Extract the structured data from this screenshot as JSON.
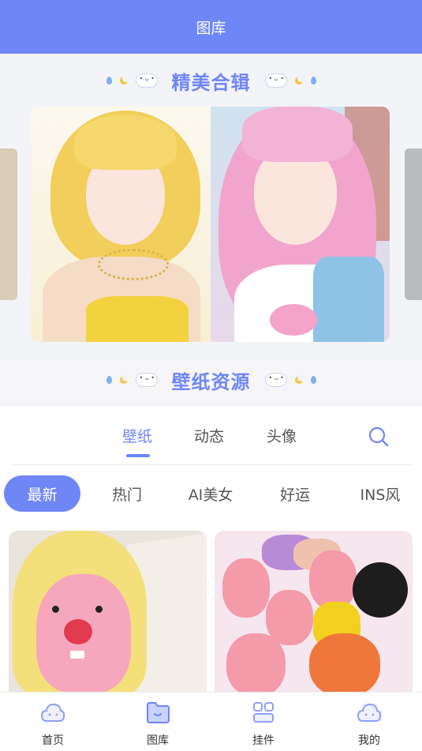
{
  "header": {
    "title": "图库"
  },
  "featured": {
    "title": "精美合辑"
  },
  "resources": {
    "title": "壁纸资源"
  },
  "main_tabs": [
    {
      "label": "壁纸",
      "active": true
    },
    {
      "label": "动态",
      "active": false
    },
    {
      "label": "头像",
      "active": false
    }
  ],
  "filters": [
    {
      "label": "最新",
      "active": true
    },
    {
      "label": "热门",
      "active": false
    },
    {
      "label": "AI美女",
      "active": false
    },
    {
      "label": "好运",
      "active": false
    },
    {
      "label": "INS风",
      "active": false
    }
  ],
  "bottom_nav": [
    {
      "label": "首页",
      "icon": "cloud-face-icon"
    },
    {
      "label": "图库",
      "icon": "folder-icon"
    },
    {
      "label": "挂件",
      "icon": "widget-icon"
    },
    {
      "label": "我的",
      "icon": "cloud-profile-icon"
    }
  ],
  "colors": {
    "accent": "#6f86f7",
    "background": "#f3f4f8"
  }
}
